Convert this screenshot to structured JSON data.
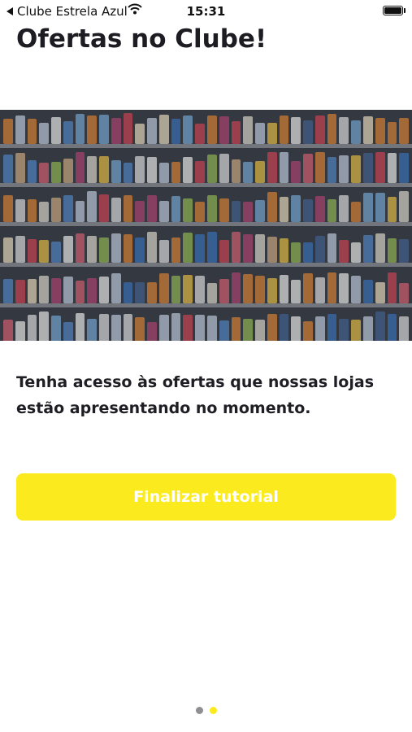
{
  "status_bar": {
    "back_label": "Clube Estrela Azul",
    "time": "15:31"
  },
  "page": {
    "title": "Ofertas no Clube!",
    "description": "Tenha acesso às ofertas que nossas lojas estão apresentando no momento.",
    "finish_button_label": "Finalizar tutorial"
  },
  "hero_image": {
    "subject": "supermarket shelves"
  },
  "pagination": {
    "count": 2,
    "active_index": 1
  },
  "colors": {
    "accent": "#fbeb1e",
    "dot_inactive": "#8e8e93",
    "text": "#1c1c22"
  }
}
